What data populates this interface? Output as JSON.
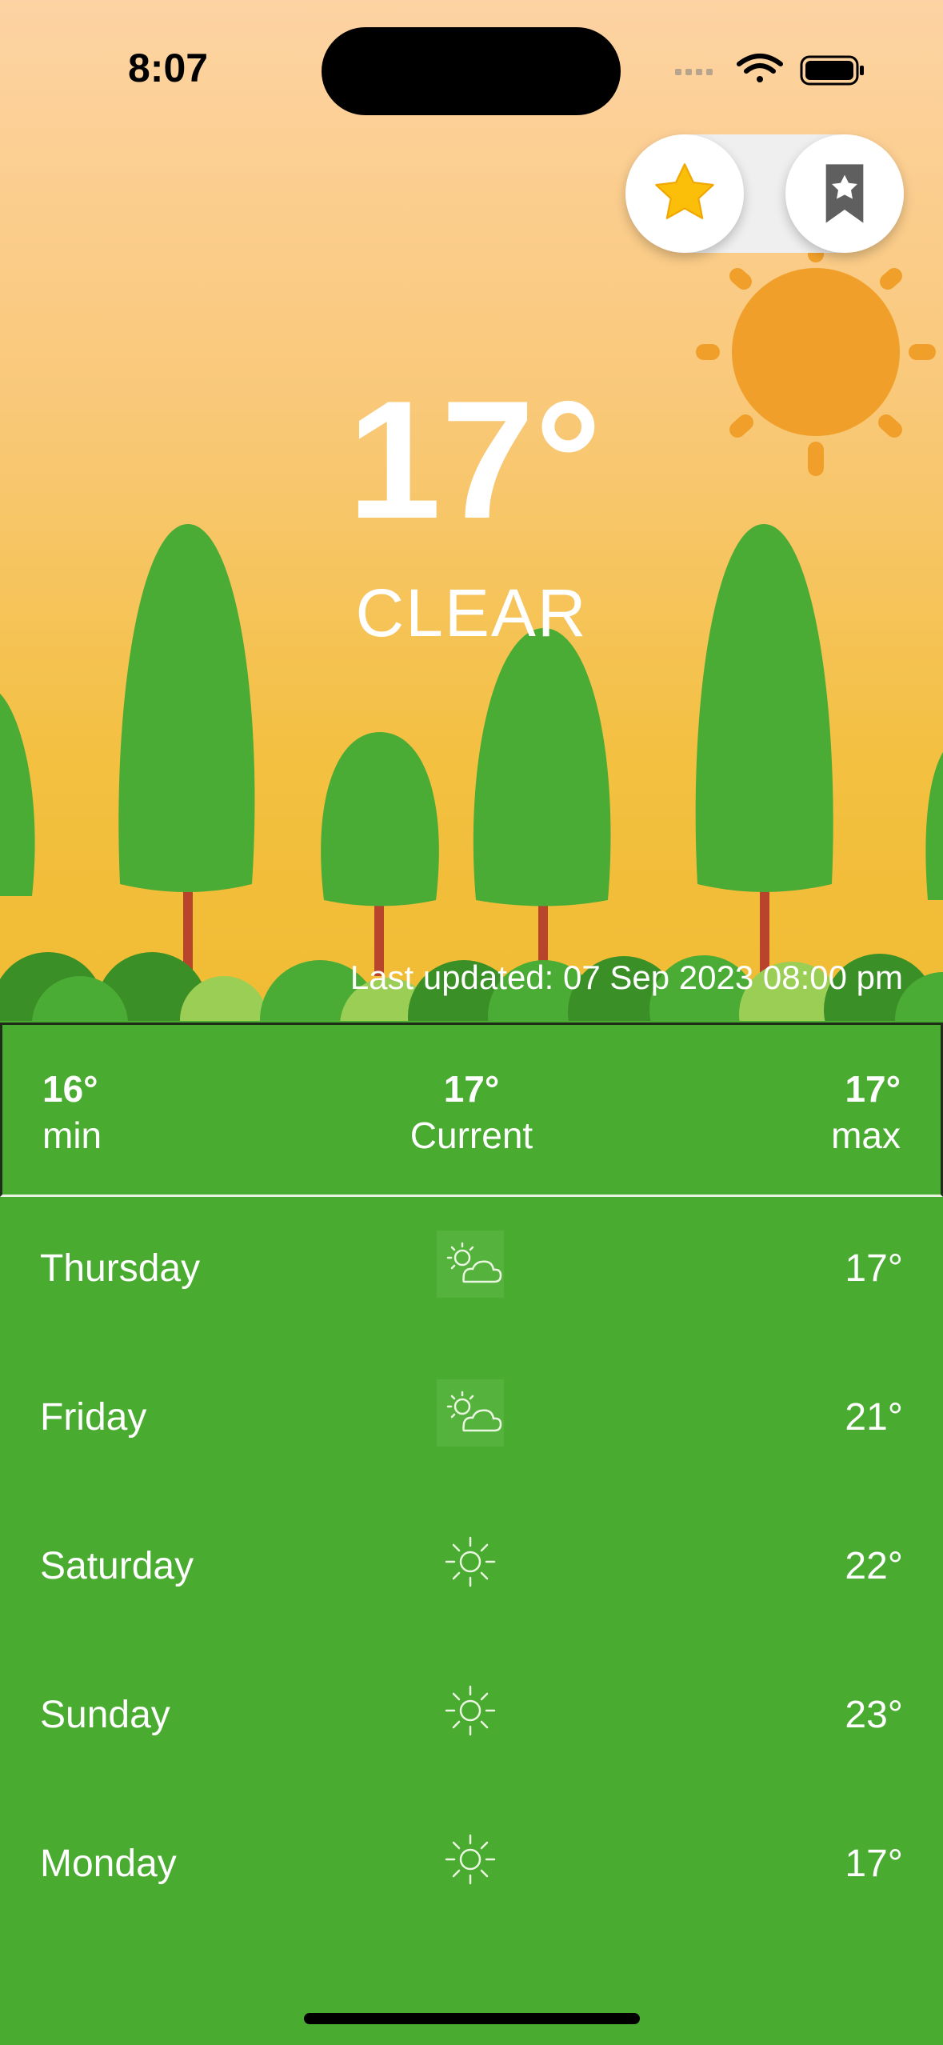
{
  "status_bar": {
    "time": "8:07"
  },
  "header_toggle": {
    "left_icon": "star-icon",
    "right_icon": "bookmark-star-icon",
    "accent": "#fbbf0a"
  },
  "current": {
    "temperature": "17°",
    "condition": "CLEAR"
  },
  "last_updated": "Last updated: 07 Sep 2023 08:00 pm",
  "summary": {
    "min": {
      "value": "16°",
      "label": "min"
    },
    "current": {
      "value": "17°",
      "label": "Current"
    },
    "max": {
      "value": "17°",
      "label": "max"
    }
  },
  "forecast": [
    {
      "day": "Thursday",
      "icon": "partly-cloudy-icon",
      "temp": "17°"
    },
    {
      "day": "Friday",
      "icon": "partly-cloudy-icon",
      "temp": "21°"
    },
    {
      "day": "Saturday",
      "icon": "sun-icon",
      "temp": "22°"
    },
    {
      "day": "Sunday",
      "icon": "sun-icon",
      "temp": "23°"
    },
    {
      "day": "Monday",
      "icon": "sun-icon",
      "temp": "17°"
    }
  ],
  "colors": {
    "green": "#49ab30",
    "tree": "#4aab35",
    "sun": "#f0a02a"
  }
}
